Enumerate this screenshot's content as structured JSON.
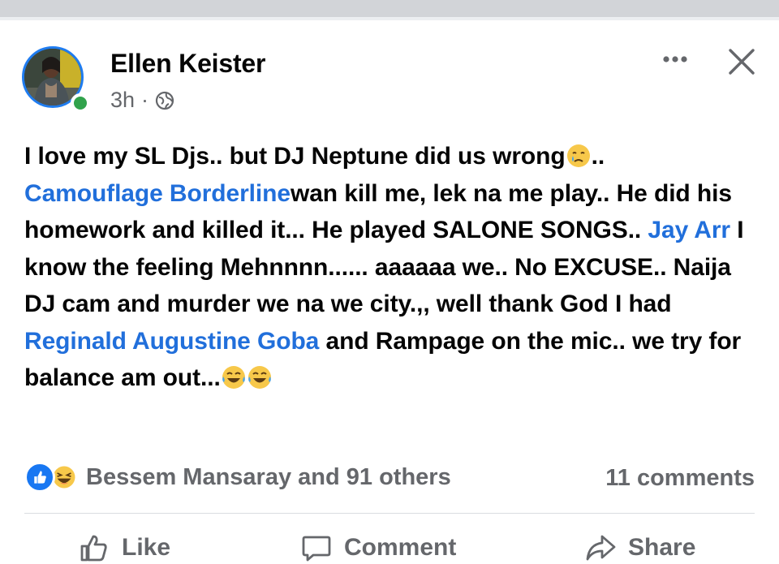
{
  "post": {
    "author": "Ellen Keister",
    "time": "3h",
    "separator": "·",
    "privacy_icon": "globe-icon",
    "body": {
      "line1_a": "I love my SL Djs.. but DJ Neptune did us wrong",
      "line1_b": "..",
      "mention1": "Camouflage Borderline",
      "text2": "wan kill me, lek na me play.. He did his homework and killed it... He played SALONE SONGS.. ",
      "mention2": "Jay Arr",
      "text3": " I know the feeling Mehnnnn...... aaaaaa we..  No EXCUSE.. Naija DJ cam and murder we na we city.,, well thank God I had ",
      "mention3": "Reginald Augustine Goba",
      "text4": " and Rampage on the mic.. we try for balance am out...",
      "emojis": [
        "crying-face",
        "tears-of-joy",
        "tears-of-joy"
      ]
    }
  },
  "reactions": {
    "icons": [
      "like-icon",
      "haha-icon"
    ],
    "summary": "Bessem Mansaray and 91 others",
    "comments": "11 comments"
  },
  "actions": {
    "like": "Like",
    "comment": "Comment",
    "share": "Share"
  },
  "colors": {
    "mention": "#216fdb",
    "online": "#31a24c",
    "like_blue": "#1877f2",
    "muted": "#65676b"
  }
}
